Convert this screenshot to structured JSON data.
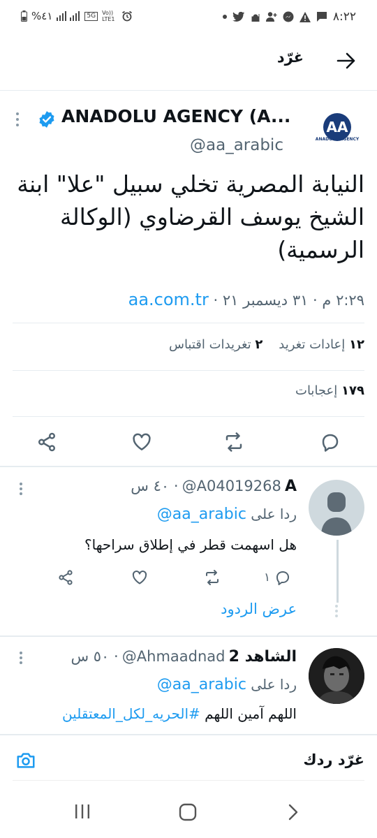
{
  "status_bar": {
    "time": "٨:٢٢",
    "battery": "%٤١",
    "network": "5G",
    "volte": "Vo)) LTE1"
  },
  "header": {
    "title": "غرّد"
  },
  "tweet": {
    "account_name": "ANADOLU AGENCY (A...",
    "handle": "@aa_arabic",
    "avatar_text": "AA",
    "avatar_sub": "ANADOLU AGENCY",
    "text": "النيابة المصرية تخلي سبيل \"علا\" ابنة الشيخ يوسف القرضاوي (الوكالة الرسمية)",
    "time": "٢:٢٩ م · ٣١ ديسمبر ٢١",
    "time_sep": "·",
    "link": "aa.com.tr",
    "retweets_count": "١٢",
    "retweets_label": "إعادات تغريد",
    "quotes_count": "٢",
    "quotes_label": "تغريدات اقتباس",
    "likes_count": "١٧٩",
    "likes_label": "إعجابات"
  },
  "replies": [
    {
      "name": "A",
      "handle": "@A04019268",
      "time": "· ٤٠ س",
      "replying_prefix": "ردا على",
      "replying_to": "@aa_arabic",
      "text": "هل اسهمت قطر في إطلاق سراحها؟",
      "reply_count": "١",
      "show_replies": "عرض الردود"
    },
    {
      "name": "الشاهد 2",
      "handle": "@Ahmaadnad",
      "time": "· ٥٠ س",
      "replying_prefix": "ردا على",
      "replying_to": "@aa_arabic",
      "text_plain": "اللهم آمين اللهم",
      "hashtag": "#الحريه_لكل_المعتقلين"
    }
  ],
  "compose": {
    "placeholder": "غرّد ردك"
  },
  "colors": {
    "accent": "#1d9bf0",
    "text": "#0f1419",
    "muted": "#536471",
    "divider": "#e6ecf0"
  }
}
